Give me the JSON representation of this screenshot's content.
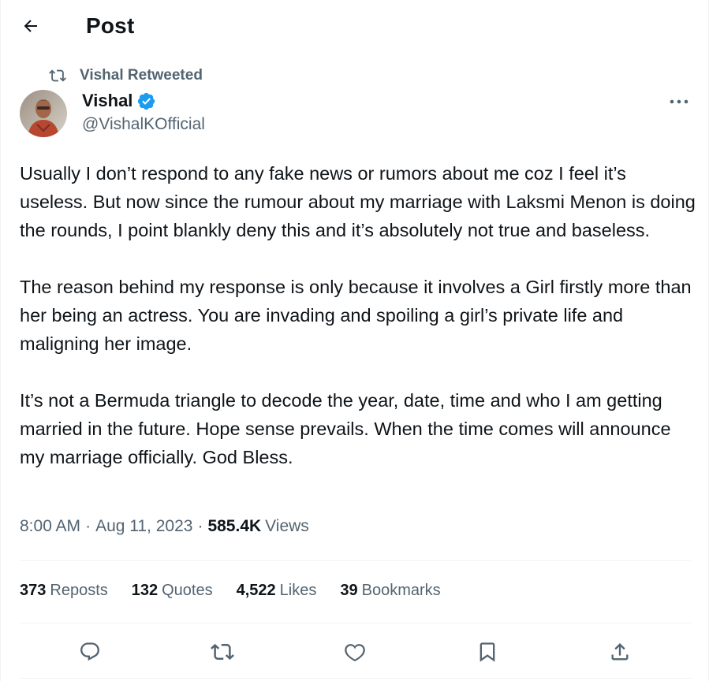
{
  "header": {
    "title": "Post"
  },
  "retweet": {
    "label": "Vishal Retweeted"
  },
  "author": {
    "name": "Vishal",
    "handle": "@VishalKOfficial"
  },
  "tweet": {
    "paragraphs": [
      "Usually I don’t respond to any fake news or rumors about me coz I feel it’s useless. But now since the rumour about my marriage with Laksmi Menon is doing the rounds, I point blankly deny this and it’s absolutely not true and baseless.",
      "The reason behind my response is only because it involves a Girl firstly more than her being an actress. You are invading and spoiling a girl’s private life and maligning her image.",
      "It’s not a Bermuda triangle to decode the year, date, time and who I am getting married in the future. Hope sense prevails. When the time comes will announce my marriage officially. God Bless."
    ],
    "time": "8:00 AM",
    "date": "Aug 11, 2023",
    "separator": "·",
    "views_count": "585.4K",
    "views_label": "Views"
  },
  "stats": {
    "reposts": {
      "count": "373",
      "label": "Reposts"
    },
    "quotes": {
      "count": "132",
      "label": "Quotes"
    },
    "likes": {
      "count": "4,522",
      "label": "Likes"
    },
    "bookmarks": {
      "count": "39",
      "label": "Bookmarks"
    }
  },
  "icons": {
    "back": "arrow-left-icon",
    "retweeted": "retweet-icon",
    "verified": "verified-badge-icon",
    "more": "more-horizontal-icon",
    "reply": "reply-icon",
    "repost": "repost-icon",
    "like": "heart-icon",
    "bookmark": "bookmark-icon",
    "share": "share-icon"
  },
  "colors": {
    "text": "#0f1419",
    "secondary": "#536471",
    "verified": "#1d9bf0",
    "divider": "#eff3f4"
  }
}
